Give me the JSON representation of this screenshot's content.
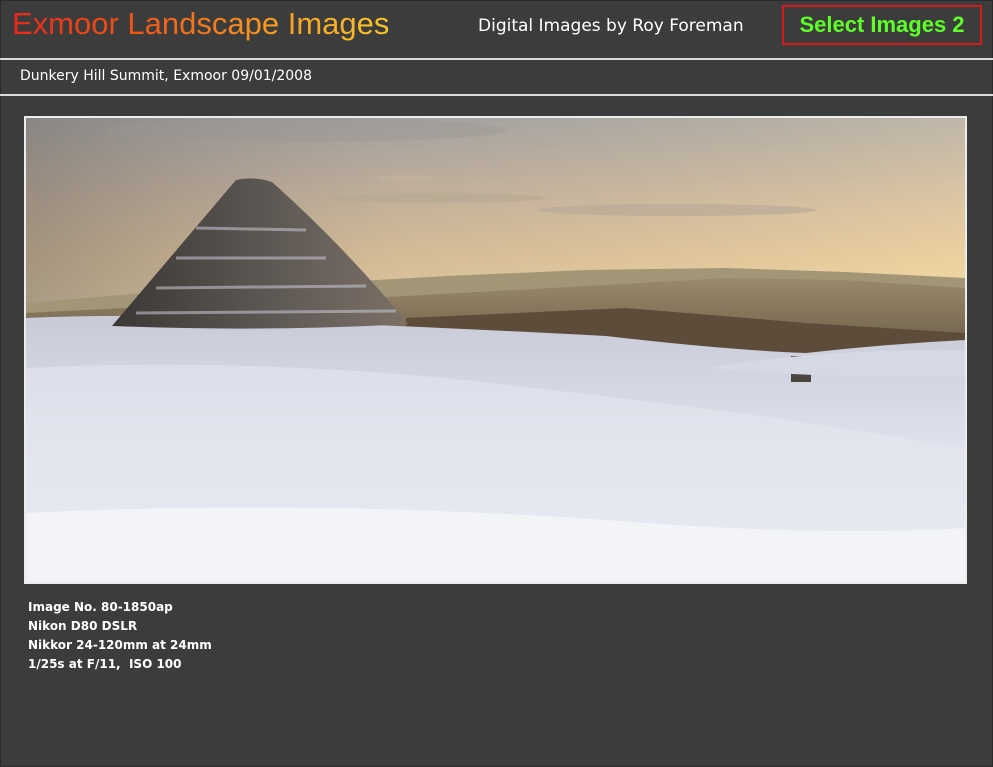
{
  "header": {
    "site_title": "Exmoor Landscape Images",
    "subtitle": "Digital Images by Roy Foreman",
    "select_button_label": "Select Images 2"
  },
  "photo": {
    "caption": "Dunkery Hill Summit, Exmoor 09/01/2008",
    "details": [
      "Image No. 80-1850ap",
      "Nikon D80 DSLR",
      "Nikkor 24-120mm at 24mm",
      "1/25s at F/11,  ISO 100"
    ]
  },
  "colors": {
    "background": "#3c3c3c",
    "select_button_text": "#5dfd28",
    "select_button_border": "#d41a1a",
    "title_gradient_start": "#e8281a",
    "title_gradient_end": "#f6c52a"
  }
}
